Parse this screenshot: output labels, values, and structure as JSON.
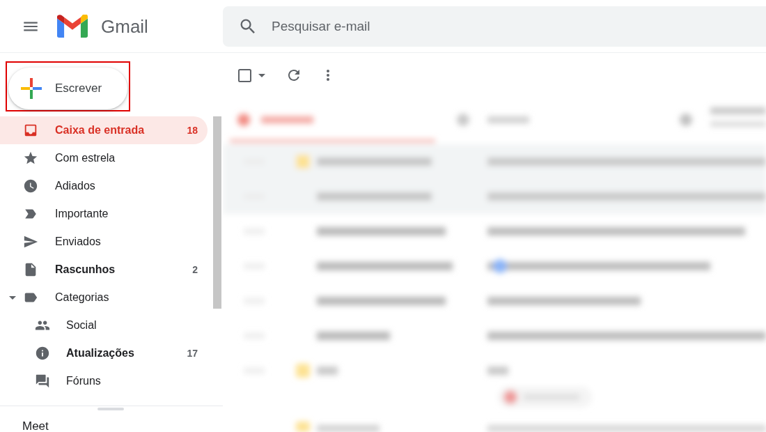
{
  "header": {
    "app_name": "Gmail",
    "search": {
      "placeholder": "Pesquisar e-mail"
    }
  },
  "compose": {
    "label": "Escrever",
    "highlighted": true
  },
  "sidebar": {
    "items": [
      {
        "label": "Caixa de entrada",
        "count": "18",
        "selected": true,
        "unread": true
      },
      {
        "label": "Com estrela",
        "selected": false,
        "unread": false
      },
      {
        "label": "Adiados",
        "selected": false,
        "unread": false
      },
      {
        "label": "Importante",
        "selected": false,
        "unread": false
      },
      {
        "label": "Enviados",
        "selected": false,
        "unread": false
      },
      {
        "label": "Rascunhos",
        "count": "2",
        "selected": false,
        "unread": true
      },
      {
        "label": "Categorias",
        "selected": false,
        "unread": false,
        "expanded": true,
        "children": [
          {
            "label": "Social",
            "selected": false,
            "unread": false
          },
          {
            "label": "Atualizações",
            "count": "17",
            "selected": false,
            "unread": true
          },
          {
            "label": "Fóruns",
            "selected": false,
            "unread": false
          }
        ]
      }
    ]
  },
  "toolbar": {
    "select_all": {
      "checked": false
    }
  },
  "meet": {
    "title": "Meet"
  }
}
